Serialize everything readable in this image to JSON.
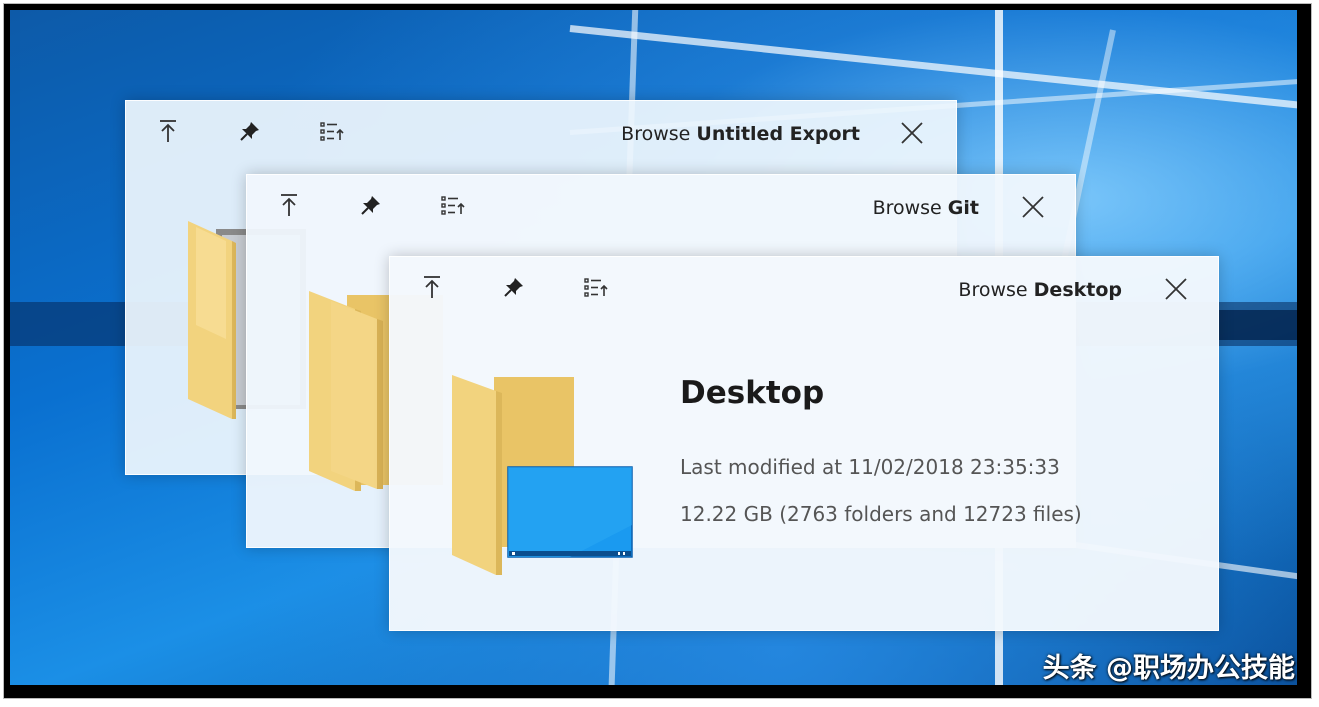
{
  "windows": [
    {
      "title_prefix": "Browse",
      "title_name": "Untitled Export",
      "toolbar": {
        "up_icon": "arrow-up-icon",
        "pin_icon": "pin-icon",
        "sort_icon": "sort-list-icon",
        "close_icon": "close-icon"
      }
    },
    {
      "title_prefix": "Browse",
      "title_name": "Git",
      "toolbar": {
        "up_icon": "arrow-up-icon",
        "pin_icon": "pin-icon",
        "sort_icon": "sort-list-icon",
        "close_icon": "close-icon"
      }
    },
    {
      "title_prefix": "Browse",
      "title_name": "Desktop",
      "toolbar": {
        "up_icon": "arrow-up-icon",
        "pin_icon": "pin-icon",
        "sort_icon": "sort-list-icon",
        "close_icon": "close-icon"
      },
      "details": {
        "name": "Desktop",
        "modified": "Last modified at 11/02/2018 23:35:33",
        "size": "12.22 GB (2763 folders and 12723 files)"
      }
    }
  ],
  "watermark": "头条 @职场办公技能",
  "colors": {
    "folder_yellow": "#f4d27a",
    "folder_shadow": "#e2b956",
    "desktop_blue": "#1a9af0",
    "window_bg": "#eef6fd"
  }
}
